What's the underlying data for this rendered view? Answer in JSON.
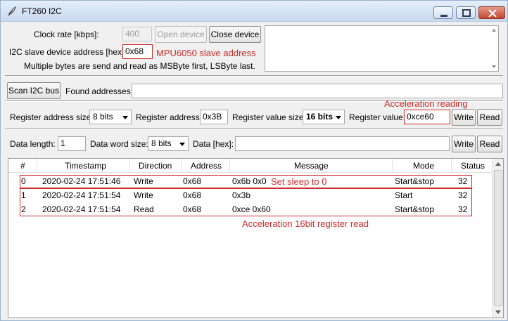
{
  "window": {
    "title": "FT260 I2C",
    "icon": "feather-icon",
    "controls": [
      "minimize-icon",
      "maximize-icon",
      "close-icon"
    ]
  },
  "device": {
    "clock_rate_label": "Clock rate [kbps]:",
    "clock_rate_value": "400",
    "open_label": "Open device",
    "close_label": "Close device",
    "slave_address_label": "I2C slave device address [hex]:",
    "slave_address_value": "0x68",
    "slave_address_note": "MPU6050 slave address",
    "info_text": "Multiple bytes are send and read as MSByte first, LSByte last."
  },
  "scan": {
    "button_label": "Scan I2C bus",
    "found_label": "Found addresses:",
    "found_value": ""
  },
  "register": {
    "annotation": "Acceleration reading",
    "addr_size_label": "Register address size:",
    "addr_size_value": "8 bits",
    "addr_label": "Register address:",
    "addr_value": "0x3B",
    "value_size_label": "Register value size:",
    "value_size_value": "16 bits",
    "value_label": "Register value:",
    "value_value": "0xce60",
    "write_label": "Write",
    "read_label": "Read"
  },
  "data": {
    "length_label": "Data length:",
    "length_value": "1",
    "word_size_label": "Data word size:",
    "word_size_value": "8 bits",
    "hex_label": "Data [hex]:",
    "hex_value": "",
    "write_label": "Write",
    "read_label": "Read"
  },
  "log": {
    "columns": [
      "#",
      "Timestamp",
      "Direction",
      "Address",
      "Message",
      "Mode",
      "Status"
    ],
    "rows": [
      {
        "n": "0",
        "timestamp": "2020-02-24 17:51:46",
        "direction": "Write",
        "address": "0x68",
        "message": "0x6b 0x0",
        "mode": "Start&stop",
        "status": "32"
      },
      {
        "n": "1",
        "timestamp": "2020-02-24 17:51:54",
        "direction": "Write",
        "address": "0x68",
        "message": "0x3b",
        "mode": "Start",
        "status": "32"
      },
      {
        "n": "2",
        "timestamp": "2020-02-24 17:51:54",
        "direction": "Read",
        "address": "0x68",
        "message": "0xce 0x60",
        "mode": "Start&stop",
        "status": "32"
      }
    ],
    "annotation_sleep": "Set sleep to 0",
    "annotation_read": "Acceleration 16bit register read"
  },
  "colors": {
    "annotation": "#cc2b2b",
    "window_bg": "#f0f0f0"
  }
}
